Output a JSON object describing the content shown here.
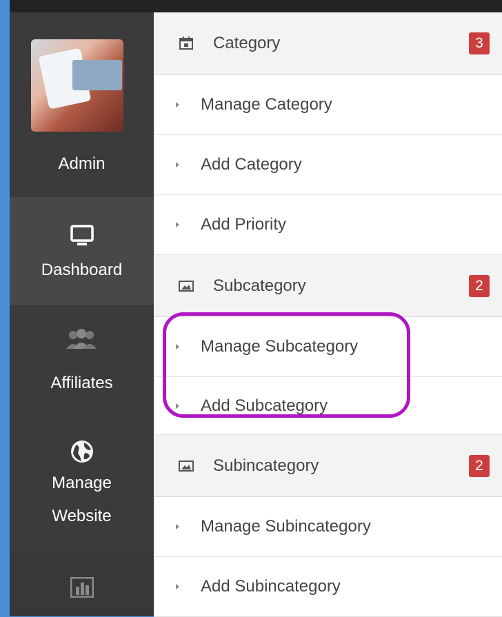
{
  "sidebar": {
    "items": [
      {
        "label": "Admin",
        "icon": "admin-avatar"
      },
      {
        "label": "Dashboard",
        "icon": "monitor-icon"
      },
      {
        "label": "Affiliates",
        "icon": "users-group-icon"
      },
      {
        "label": "Manage\nWebsite",
        "icon": "globe-icon"
      },
      {
        "label": "",
        "icon": "bar-chart-icon"
      }
    ]
  },
  "menu": {
    "category": {
      "label": "Category",
      "badge": "3",
      "icon": "calendar-icon",
      "items": [
        "Manage Category",
        "Add Category",
        "Add Priority"
      ]
    },
    "subcategory": {
      "label": "Subcategory",
      "badge": "2",
      "icon": "image-icon",
      "items": [
        "Manage Subcategory",
        "Add Subcategory"
      ]
    },
    "subincategory": {
      "label": "Subincategory",
      "badge": "2",
      "icon": "image-icon",
      "items": [
        "Manage Subincategory",
        "Add Subincategory"
      ]
    }
  },
  "colors": {
    "badge": "#cc3d3d",
    "highlight": "#b016c4",
    "sidebar": "#3a3a3a"
  }
}
